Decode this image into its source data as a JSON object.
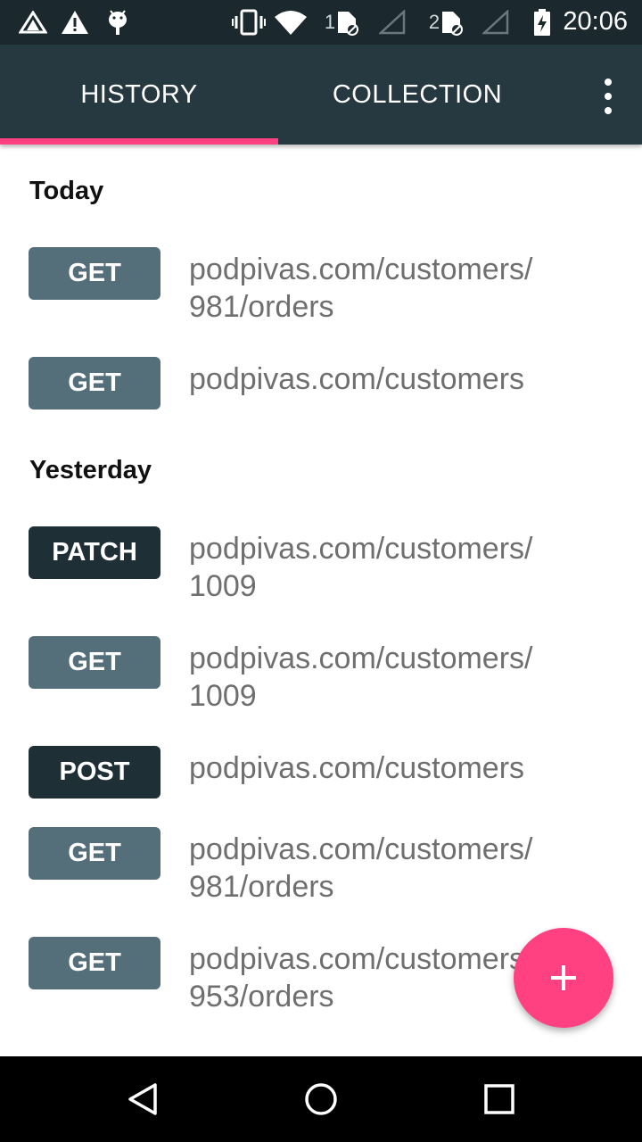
{
  "status_bar": {
    "time": "20:06",
    "sim1_label": "1",
    "sim2_label": "2",
    "icons": [
      "app-notification-icon",
      "warning-icon",
      "android-debug-icon",
      "vibrate-icon",
      "wifi-icon",
      "sim1-icon",
      "signal1-icon",
      "sim2-icon",
      "signal2-icon",
      "battery-charging-icon"
    ]
  },
  "tabs": {
    "history": "HISTORY",
    "collection": "COLLECTION",
    "selected": "history"
  },
  "colors": {
    "app_bar": "#263840",
    "status_bar": "#1b282e",
    "accent": "#ff4081",
    "get_badge": "#546e7a",
    "mutating_badge": "#1f2f36",
    "url_text": "#6f6f6f"
  },
  "sections": [
    {
      "title": "Today",
      "requests": [
        {
          "method": "GET",
          "url": "podpivas.com/customers/ 981/orders"
        },
        {
          "method": "GET",
          "url": "podpivas.com/customers"
        }
      ]
    },
    {
      "title": "Yesterday",
      "requests": [
        {
          "method": "PATCH",
          "url": "podpivas.com/customers/ 1009"
        },
        {
          "method": "GET",
          "url": "podpivas.com/customers/ 1009"
        },
        {
          "method": "POST",
          "url": "podpivas.com/customers"
        },
        {
          "method": "GET",
          "url": "podpivas.com/customers/ 981/orders"
        },
        {
          "method": "GET",
          "url": "podpivas.com/customers/ 953/orders"
        }
      ]
    }
  ],
  "fab": {
    "icon": "plus-icon"
  },
  "nav_bar": {
    "icons": [
      "back-icon",
      "home-icon",
      "recents-icon"
    ]
  }
}
